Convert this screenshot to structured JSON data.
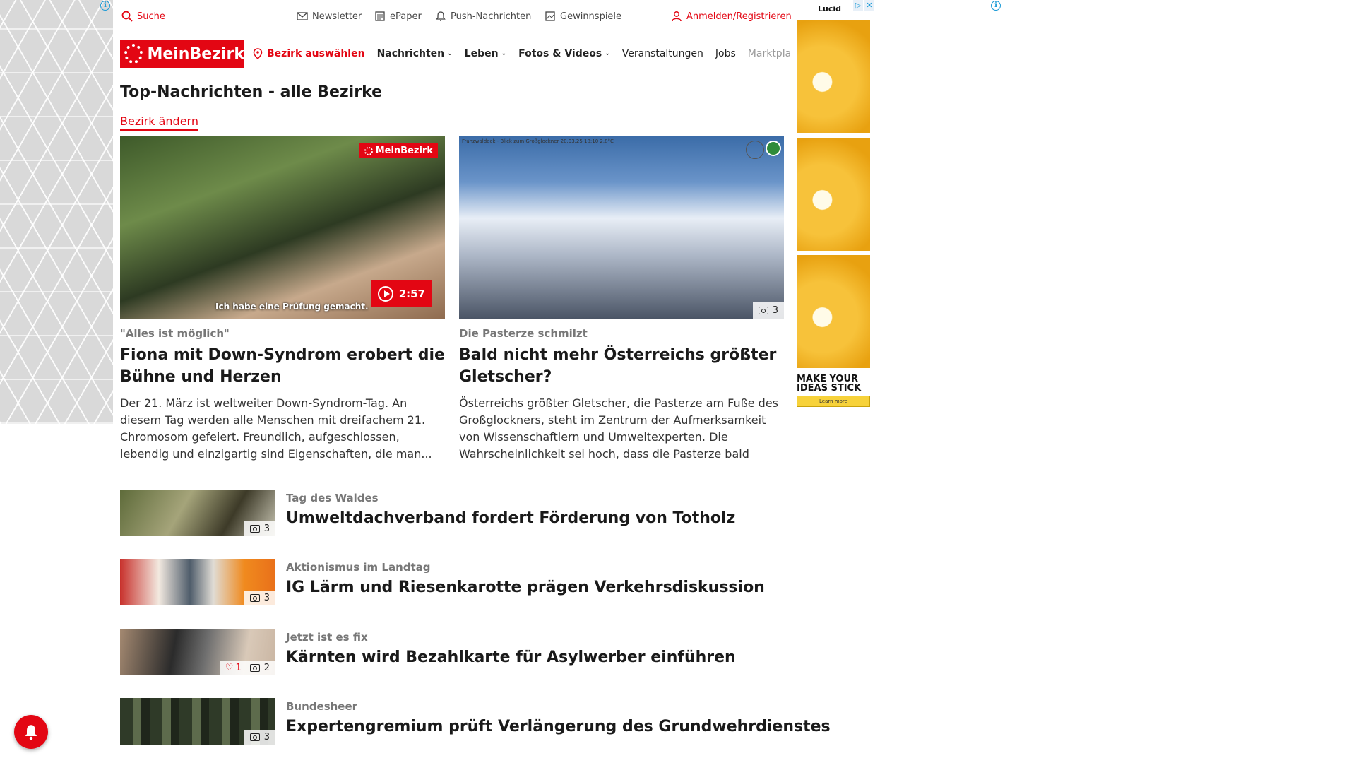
{
  "topbar": {
    "search": "Suche",
    "newsletter": "Newsletter",
    "epaper": "ePaper",
    "push": "Push-Nachrichten",
    "gewinnspiele": "Gewinnspiele",
    "login": "Anmelden/Registrieren"
  },
  "nav": {
    "logo": "MeinBezirk",
    "bezirk": "Bezirk auswählen",
    "items": [
      "Nachrichten",
      "Leben",
      "Fotos & Videos",
      "Veranstaltungen",
      "Jobs",
      "Marktplatz"
    ]
  },
  "section": {
    "title": "Top-Nachrichten - alle Bezirke",
    "change_link": "Bezirk ändern"
  },
  "features": [
    {
      "brand_badge": "MeinBezirk",
      "video_duration": "2:57",
      "caption": "Ich habe eine Prüfung gemacht.",
      "kicker": "\"Alles ist möglich\"",
      "title": "Fiona mit Down-Syndrom erobert die Bühne und Herzen",
      "teaser": "Der 21. März ist weltweiter Down-Syndrom-Tag. An diesem Tag werden alle Menschen mit dreifachem 21. Chromosom gefeiert. Freundlich, aufgeschlossen, lebendig und einzigartig sind Eigenschaften, die man..."
    },
    {
      "image_caption": "Franzwaldeck - Blick zum Großglockner 20.03.25 18:10 2.8°C",
      "photo_count": "3",
      "kicker": "Die Pasterze schmilzt",
      "title": "Bald nicht mehr Österreichs größter Gletscher?",
      "teaser": "Österreichs größter Gletscher, die Pasterze am Fuße des Großglockners, steht im Zentrum der Aufmerksamkeit von Wissenschaftlern und Umweltexperten. Die Wahrscheinlichkeit sei hoch, dass die Pasterze bald nich..."
    }
  ],
  "list": [
    {
      "kicker": "Tag des Waldes",
      "title": "Umweltdachverband fordert Förderung von Totholz",
      "photos": "3",
      "likes": ""
    },
    {
      "kicker": "Aktionismus im Landtag",
      "title": "IG Lärm und Riesenkarotte prägen Verkehrsdiskussion",
      "photos": "3",
      "likes": ""
    },
    {
      "kicker": "Jetzt ist es fix",
      "title": "Kärnten wird Bezahlkarte für Asylwerber einführen",
      "photos": "2",
      "likes": "1"
    },
    {
      "kicker": "Bundesheer",
      "title": "Expertengremium prüft Verlängerung des Grundwehrdienstes",
      "photos": "3",
      "likes": ""
    }
  ],
  "ad": {
    "brand": "Lucid",
    "headline": "MAKE YOUR IDEAS STICK",
    "cta": "Learn more"
  },
  "colors": {
    "brand_red": "#e30613"
  }
}
